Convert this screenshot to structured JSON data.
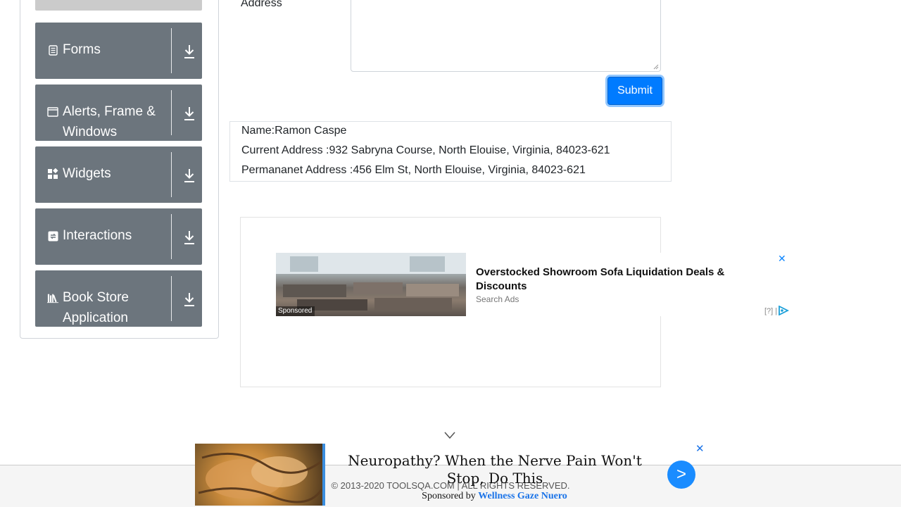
{
  "sidebar": {
    "groups": [
      {
        "label": "Forms",
        "icon": "document-icon"
      },
      {
        "label": "Alerts, Frame & Windows",
        "icon": "window-icon"
      },
      {
        "label": "Widgets",
        "icon": "widgets-icon"
      },
      {
        "label": "Interactions",
        "icon": "interactions-icon"
      },
      {
        "label": "Book Store Application",
        "icon": "books-icon"
      }
    ]
  },
  "form": {
    "address_label": "Address",
    "submit_label": "Submit"
  },
  "output": {
    "name": "Name:Ramon Caspe",
    "current_address": "Current Address :932 Sabryna Course, North Elouise, Virginia, 84023-621",
    "permanent_address": "Permananet Address :456 Elm St, North Elouise, Virginia, 84023-621"
  },
  "ad": {
    "sponsored": "Sponsored",
    "title": "Overstocked Showroom Sofa Liquidation Deals & Discounts",
    "source": "Search Ads",
    "info": "[?] |",
    "close": "✕"
  },
  "footer": {
    "copyright": "© 2013-2020 TOOLSQA.COM | ALL RIGHTS RESERVED."
  },
  "bottom_ad": {
    "title": "Neuropathy? When the Nerve Pain Won't Stop, Do This",
    "sponsored_prefix": "Sponsored by",
    "sponsor": "Wellness Gaze Nuero",
    "go": ">",
    "close": "✕"
  },
  "colors": {
    "accent": "#007bff",
    "sidebar_group": "#6c757d"
  }
}
